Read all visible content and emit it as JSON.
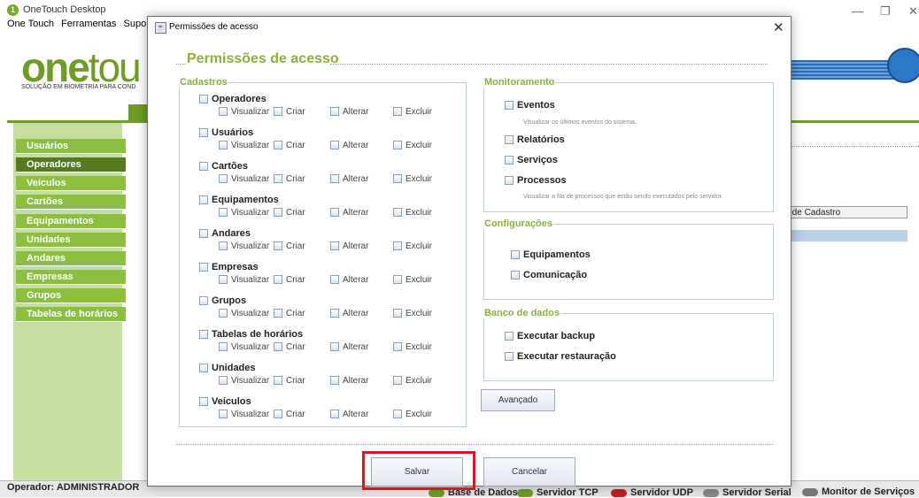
{
  "app": {
    "title": "OneTouch Desktop",
    "menu": [
      "One Touch",
      "Ferramentas",
      "Suporte"
    ],
    "logo_main": "one",
    "logo_thin": "tou",
    "tagline": "SOLUÇÃO EM BIOMETRIA PARA COND",
    "sidebar": [
      "Usuários",
      "Operadores",
      "Veículos",
      "Cartões",
      "Equipamentos",
      "Unidades",
      "Andares",
      "Empresas",
      "Grupos",
      "Tabelas de horários"
    ],
    "sidebar_active": "Operadores",
    "table_header": "ata de Cadastro",
    "operator": "Operador: ADMINISTRADOR",
    "status_items": [
      "Base de Dados",
      "Servidor TCP",
      "Servidor UDP",
      "Servidor Serial",
      "Monitor de Serviços"
    ],
    "colors": {
      "brand_green": "#6e9c26",
      "sidebar_green": "#8cbf3f",
      "sidebar_active": "#557a1f",
      "accent_label": "#8ab13b"
    }
  },
  "dialog": {
    "title": "Permissões de acesso",
    "heading": "Permissões de acesso",
    "cadastros": {
      "legend": "Cadastros",
      "perm_labels": [
        "Visualizar",
        "Criar",
        "Alterar",
        "Excluir"
      ],
      "groups": [
        "Operadores",
        "Usuários",
        "Cartões",
        "Equipamentos",
        "Andares",
        "Empresas",
        "Grupos",
        "Tabelas de horários",
        "Unidades",
        "Veículos"
      ]
    },
    "monitoramento": {
      "legend": "Monitoramento",
      "eventos": "Eventos",
      "eventos_desc": "Visualizar os últimos eventos do sistema.",
      "relatorios": "Relatórios",
      "servicos": "Serviços",
      "processos": "Processos",
      "processos_desc": "Visualizar a fila de processos que estão sendo executados pelo servidor."
    },
    "configuracoes": {
      "legend": "Configurações",
      "equipamentos": "Equipamentos",
      "comunicacao": "Comunicação"
    },
    "banco": {
      "legend": "Banco de dados",
      "backup": "Executar backup",
      "restauracao": "Executar restauração"
    },
    "avancado": "Avançado",
    "salvar": "Salvar",
    "cancelar": "Cancelar"
  }
}
